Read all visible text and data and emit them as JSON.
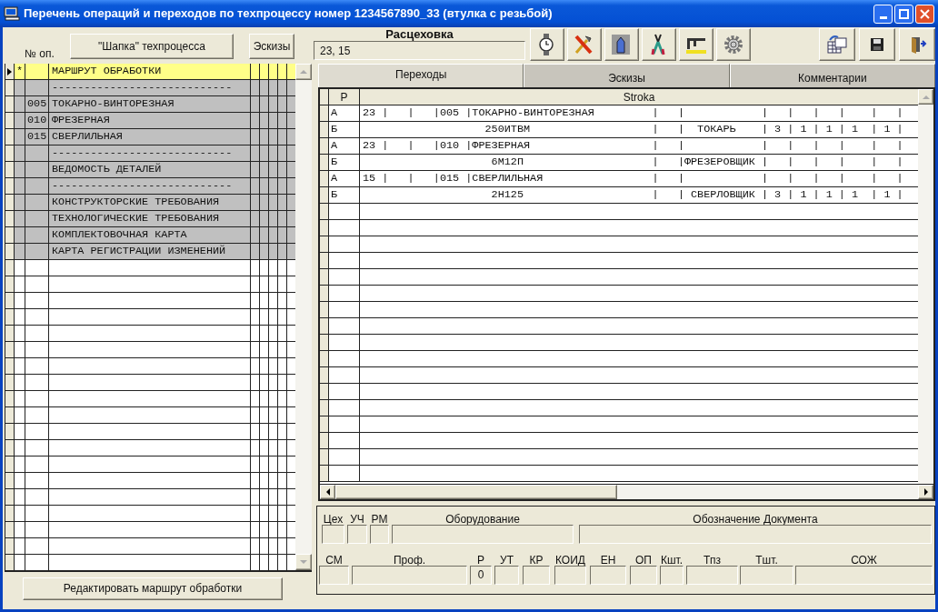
{
  "window": {
    "title": "Перечень операций и переходов по техпроцессу номер 1234567890_33 (втулка с резьбой)"
  },
  "left": {
    "op_label": "№ оп.",
    "header_button": "\"Шапка\" техпроцесса",
    "sketch_button": "Эскизы",
    "rows": [
      {
        "marker": "*",
        "text": "МАРШРУТ ОБРАБОТКИ",
        "selected": true
      },
      {
        "text": "----------------------------",
        "selected": false
      },
      {
        "num": "005",
        "text": "ТОКАРНО-ВИНТОРЕЗНАЯ",
        "selected": false
      },
      {
        "num": "010",
        "text": "ФРЕЗЕРНАЯ",
        "selected": false
      },
      {
        "num": "015",
        "text": "СВЕРЛИЛЬНАЯ",
        "selected": false
      },
      {
        "text": "----------------------------",
        "selected": false
      },
      {
        "text": "ВЕДОМОСТЬ ДЕТАЛЕЙ",
        "selected": false
      },
      {
        "text": "----------------------------",
        "selected": false
      },
      {
        "text": "КОНСТРУКТОРСКИЕ ТРЕБОВАНИЯ",
        "selected": false
      },
      {
        "text": "ТЕХНОЛОГИЧЕСКИЕ ТРЕБОВАНИЯ",
        "selected": false
      },
      {
        "text": "КОМПЛЕКТОВОЧНАЯ КАРТА",
        "selected": false
      },
      {
        "text": "КАРТА РЕГИСТРАЦИИ ИЗМЕНЕНИЙ",
        "selected": false
      }
    ],
    "edit_button": "Редактировать маршрут обработки"
  },
  "shop_route": {
    "label": "Расцеховка",
    "value": "23, 15"
  },
  "tabs": [
    {
      "label": "Переходы",
      "selected": true
    },
    {
      "label": "Эскизы",
      "selected": false
    },
    {
      "label": "Комментарии",
      "selected": false
    }
  ],
  "table": {
    "columns": [
      "Р",
      "Stroka"
    ],
    "rows": [
      {
        "p": "А",
        "stroka": "23 |   |   |005 |ТОКАРНО-ВИНТОРЕЗНАЯ         |   |            |   |   |   |    |   |"
      },
      {
        "p": "Б",
        "stroka": "                   250ИТВМ                   |   |  ТОКАРЬ    | 3 | 1 | 1 | 1  | 1 |"
      },
      {
        "p": "А",
        "stroka": "23 |   |   |010 |ФРЕЗЕРНАЯ                   |   |            |   |   |   |    |   |"
      },
      {
        "p": "Б",
        "stroka": "                    6М12П                    |   |ФРЕЗЕРОВЩИК |   |   |   |    |   |"
      },
      {
        "p": "А",
        "stroka": "15 |   |   |015 |СВЕРЛИЛЬНАЯ                 |   |            |   |   |   |    |   |"
      },
      {
        "p": "Б",
        "stroka": "                    2Н125                    |   | СВЕРЛОВЩИК | 3 | 1 | 1 | 1  | 1 |"
      }
    ]
  },
  "details": {
    "row_1": [
      {
        "label": "Цех"
      },
      {
        "label": "УЧ"
      },
      {
        "label": "РМ"
      },
      {
        "label": "Оборудование"
      },
      {
        "label": "Обозначение Документа"
      }
    ],
    "row_2": [
      {
        "label": "СМ"
      },
      {
        "label": "Проф."
      },
      {
        "label": "Р",
        "value": "0"
      },
      {
        "label": "УТ"
      },
      {
        "label": "КР"
      },
      {
        "label": "КОИД"
      },
      {
        "label": "ЕН"
      },
      {
        "label": "ОП"
      },
      {
        "label": "Кшт."
      },
      {
        "label": "Тпз"
      },
      {
        "label": "Тшт."
      },
      {
        "label": "СОЖ"
      }
    ]
  }
}
